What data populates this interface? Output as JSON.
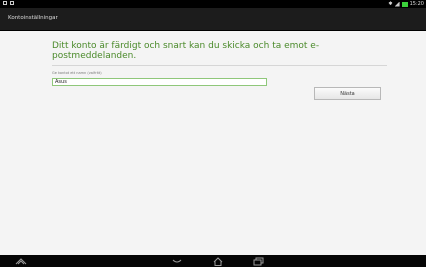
{
  "status_bar": {
    "time": "15:20"
  },
  "action_bar": {
    "title": "Kontoinställningar"
  },
  "main": {
    "heading": "Ditt konto är färdigt och snart kan du skicka och ta emot e-postmeddelanden.",
    "name_label": "Ge kontot ett namn (valfritt)",
    "name_value": "Asus",
    "next_label": "Nästa"
  },
  "nav_bar": {
    "icons": [
      "shortcut-icon",
      "back-icon",
      "home-icon",
      "recent-apps-icon"
    ]
  },
  "colors": {
    "accent": "#4a8a2a",
    "battery": "#3bd13b"
  }
}
